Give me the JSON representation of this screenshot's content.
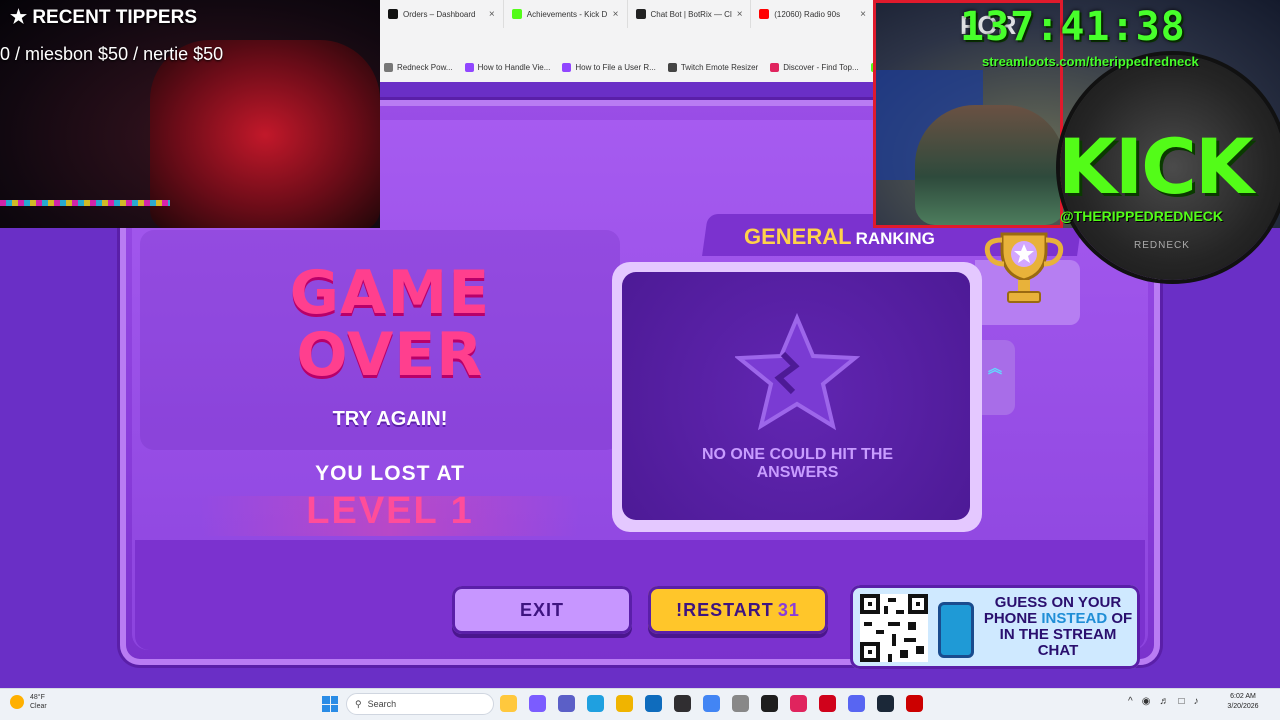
{
  "browser": {
    "tabs": [
      {
        "label": "Orders – Dashboard",
        "icon": "dashboard-icon",
        "color": "#111111"
      },
      {
        "label": "Achievements - Kick D",
        "icon": "kick-icon",
        "color": "#53fc18"
      },
      {
        "label": "Chat Bot | BotRix — Cl",
        "icon": "botrix-icon",
        "color": "#222222"
      },
      {
        "label": "(12060) Radio 90s",
        "icon": "youtube-icon",
        "color": "#ff0000"
      }
    ],
    "bookmarks": [
      {
        "label": "Redneck Pow...",
        "color": "#777777"
      },
      {
        "label": "How to Handle Vie...",
        "color": "#9146ff"
      },
      {
        "label": "How to File a User R...",
        "color": "#9146ff"
      },
      {
        "label": "Twitch Emote Resizer",
        "color": "#444444"
      },
      {
        "label": "Discover - Find Top...",
        "color": "#e0245e"
      },
      {
        "label": "",
        "color": "#53fc18"
      }
    ]
  },
  "game": {
    "title": "GAME OVER",
    "try_again": "TRY AGAIN!",
    "lost_at": "YOU LOST AT",
    "level": "LEVEL 1",
    "ranking_label": "GENERAL",
    "ranking_sub": "RANKING",
    "no_one_text": "NO ONE COULD HIT THE ANSWERS",
    "exit_label": "EXIT",
    "restart_label": "!RESTART",
    "restart_count": "31",
    "qr_text_1": "GUESS ON YOUR PHONE",
    "qr_text_hl": "INSTEAD",
    "qr_text_2": "OF IN THE STREAM CHAT"
  },
  "overlay": {
    "tippers_title": "RECENT TIPPERS",
    "tippers_list": "0 /     miesbon $50 / nertie $50",
    "timer_prefix": "POR",
    "timer": "137:41:38",
    "streamloots": "streamloots.com/therippedredneck",
    "kick": "KICK",
    "kick_handle": "@THERIPPEDREDNECK",
    "redneck": "REDNECK"
  },
  "taskbar": {
    "temp": "48°F",
    "weather": "Clear",
    "search_placeholder": "Search",
    "time": "6:02 AM",
    "date": "3/20/2026",
    "apps": [
      {
        "name": "file-explorer-icon",
        "color": "#ffc83d"
      },
      {
        "name": "copilot-icon",
        "color": "#7b5cff"
      },
      {
        "name": "teams-icon",
        "color": "#5b5fc7"
      },
      {
        "name": "edge-icon",
        "color": "#1fa0e0"
      },
      {
        "name": "folder-icon",
        "color": "#f0b400"
      },
      {
        "name": "outlook-icon",
        "color": "#0f6cbd"
      },
      {
        "name": "obs-icon",
        "color": "#302e31"
      },
      {
        "name": "chrome-icon",
        "color": "#4285f4"
      },
      {
        "name": "fan-icon",
        "color": "#888888"
      },
      {
        "name": "terminal-icon",
        "color": "#1e1e1e"
      },
      {
        "name": "heartbeat-icon",
        "color": "#e0245e"
      },
      {
        "name": "game-icon",
        "color": "#d0021b"
      },
      {
        "name": "discord-icon",
        "color": "#5865f2"
      },
      {
        "name": "steam-icon",
        "color": "#1b2838"
      },
      {
        "name": "record-icon",
        "color": "#cc0000"
      }
    ]
  }
}
